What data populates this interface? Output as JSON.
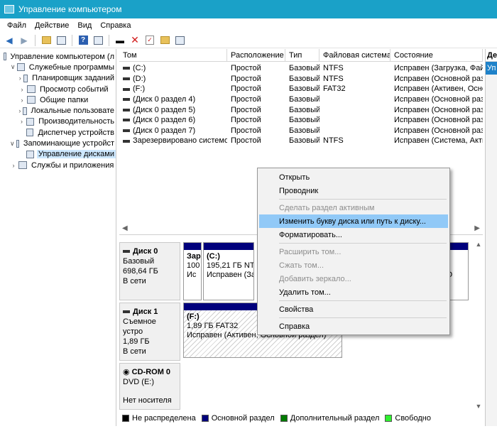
{
  "window": {
    "title": "Управление компьютером"
  },
  "menu": [
    "Файл",
    "Действие",
    "Вид",
    "Справка"
  ],
  "tree": {
    "items": [
      {
        "label": "Управление компьютером (л",
        "level": 0,
        "expander": ""
      },
      {
        "label": "Служебные программы",
        "level": 1,
        "expander": "v"
      },
      {
        "label": "Планировщик заданий",
        "level": 2,
        "expander": ">"
      },
      {
        "label": "Просмотр событий",
        "level": 2,
        "expander": ">"
      },
      {
        "label": "Общие папки",
        "level": 2,
        "expander": ">"
      },
      {
        "label": "Локальные пользовате",
        "level": 2,
        "expander": ">"
      },
      {
        "label": "Производительность",
        "level": 2,
        "expander": ">"
      },
      {
        "label": "Диспетчер устройств",
        "level": 2,
        "expander": ""
      },
      {
        "label": "Запоминающие устройст",
        "level": 1,
        "expander": "v"
      },
      {
        "label": "Управление дисками",
        "level": 2,
        "expander": "",
        "selected": true
      },
      {
        "label": "Службы и приложения",
        "level": 1,
        "expander": ">"
      }
    ]
  },
  "volumes": {
    "headers": [
      "Том",
      "Расположение",
      "Тип",
      "Файловая система",
      "Состояние"
    ],
    "rows": [
      [
        "(C:)",
        "Простой",
        "Базовый",
        "NTFS",
        "Исправен (Загрузка, Фай"
      ],
      [
        "(D:)",
        "Простой",
        "Базовый",
        "NTFS",
        "Исправен (Основной разд"
      ],
      [
        "(F:)",
        "Простой",
        "Базовый",
        "FAT32",
        "Исправен (Активен, Осно"
      ],
      [
        "(Диск 0 раздел 4)",
        "Простой",
        "Базовый",
        "",
        "Исправен (Основной разд"
      ],
      [
        "(Диск 0 раздел 5)",
        "Простой",
        "Базовый",
        "",
        "Исправен (Основной разд"
      ],
      [
        "(Диск 0 раздел 6)",
        "Простой",
        "Базовый",
        "",
        "Исправен (Основной разд"
      ],
      [
        "(Диск 0 раздел 7)",
        "Простой",
        "Базовый",
        "",
        "Исправен (Основной разд"
      ],
      [
        "Зарезервировано системой",
        "Простой",
        "Базовый",
        "NTFS",
        "Исправен (Система, Акти"
      ]
    ]
  },
  "actions_panel": {
    "header": "Де",
    "selected": "Уп"
  },
  "disks": {
    "disk0": {
      "name": "Диск 0",
      "type": "Базовый",
      "size": "698,64 ГБ",
      "status": "В сети",
      "part_sys": {
        "line1": "Зар",
        "line2": "100",
        "line3": "Ис"
      },
      "part_c": {
        "line1": "(C:)",
        "line2": "195,21 ГБ NTI",
        "line3": "Исправен (За"
      },
      "part_right": {
        "line2": "Б",
        "line3": "(О"
      }
    },
    "disk1": {
      "name": "Диск 1",
      "type": "Съемное устро",
      "size": "1,89 ГБ",
      "status": "В сети",
      "part_f": {
        "line1": "(F:)",
        "line2": "1,89 ГБ FAT32",
        "line3": "Исправен (Активен, Основной раздел)"
      }
    },
    "cdrom": {
      "name": "CD-ROM 0",
      "type": "DVD (E:)",
      "status": "Нет носителя"
    }
  },
  "legend": [
    {
      "label": "Не распределена",
      "color": "#000000"
    },
    {
      "label": "Основной раздел",
      "color": "#00007c"
    },
    {
      "label": "Дополнительный раздел",
      "color": "#007a00"
    },
    {
      "label": "Свободно",
      "color": "#2ef02e"
    }
  ],
  "context_menu": {
    "items": [
      {
        "label": "Открыть",
        "enabled": true
      },
      {
        "label": "Проводник",
        "enabled": true
      },
      {
        "sep": true
      },
      {
        "label": "Сделать раздел активным",
        "enabled": false
      },
      {
        "label": "Изменить букву диска или путь к диску...",
        "enabled": true,
        "highlighted": true
      },
      {
        "label": "Форматировать...",
        "enabled": true
      },
      {
        "sep": true
      },
      {
        "label": "Расширить том...",
        "enabled": false
      },
      {
        "label": "Сжать том...",
        "enabled": false
      },
      {
        "label": "Добавить зеркало...",
        "enabled": false
      },
      {
        "label": "Удалить том...",
        "enabled": true
      },
      {
        "sep": true
      },
      {
        "label": "Свойства",
        "enabled": true
      },
      {
        "sep": true
      },
      {
        "label": "Справка",
        "enabled": true
      }
    ]
  }
}
